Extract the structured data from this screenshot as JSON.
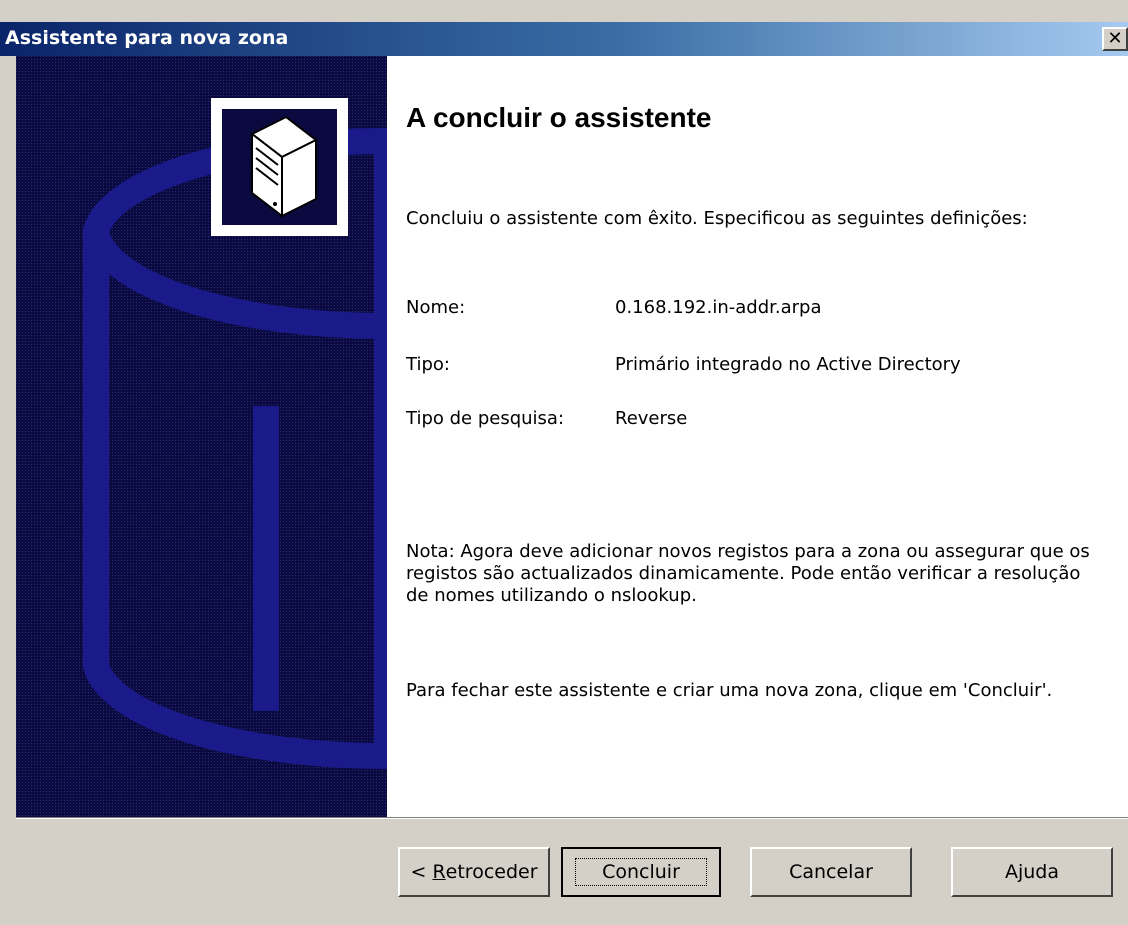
{
  "window": {
    "title": "Assistente para nova zona",
    "close_glyph": "✕"
  },
  "content": {
    "heading": "A concluir o assistente",
    "intro": "Concluiu o assistente com êxito. Especificou as seguintes definições:",
    "settings": [
      {
        "label": "Nome:",
        "value": "0.168.192.in-addr.arpa"
      },
      {
        "label": "Tipo:",
        "value": "Primário integrado no Active Directory"
      },
      {
        "label": "Tipo de pesquisa:",
        "value": "Reverse"
      }
    ],
    "note": "Nota: Agora deve adicionar novos registos para a zona ou assegurar que os registos são actualizados dinamicamente. Pode então verificar a resolução de nomes utilizando o nslookup.",
    "closing": "Para fechar este assistente e criar uma nova zona, clique em 'Concluir'."
  },
  "buttons": {
    "back_prefix": "< ",
    "back_mnemonic": "R",
    "back_rest": "etroceder",
    "finish": "Concluir",
    "cancel": "Cancelar",
    "help": "Ajuda"
  },
  "icons": {
    "side_panel": "database-server-icon",
    "close": "close-icon"
  },
  "colors": {
    "titlebar_start": "#0a246a",
    "titlebar_end": "#a6caf0",
    "side_panel": "#0a0a40",
    "cylinder": "#1a1a8a",
    "face": "#d4d0c8"
  }
}
